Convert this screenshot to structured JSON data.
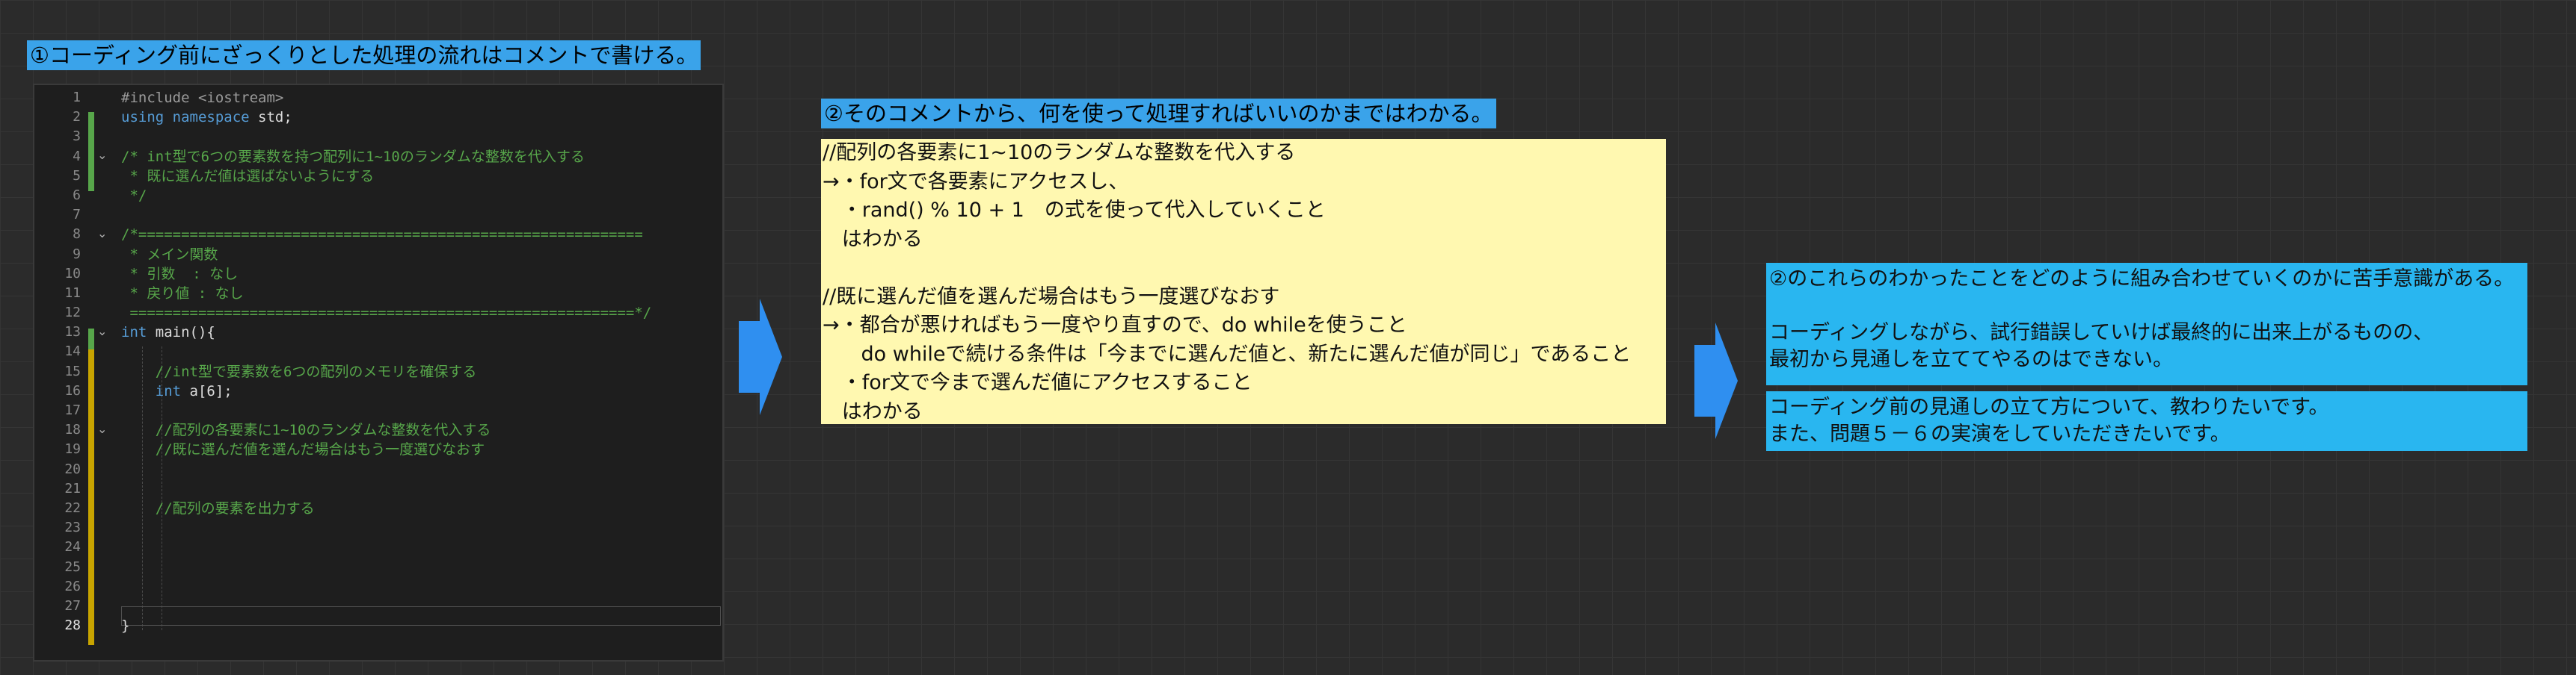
{
  "colors": {
    "canvas_bg": "#2b2b2b",
    "label_bg": "#3aa3ea",
    "note_bg": "#fff8b0",
    "box_bg": "#29b6f0",
    "arrow": "#2f8ff0",
    "editor_bg": "#1e1e1e"
  },
  "label1": "①コーディング前にざっくりとした処理の流れはコメントで書ける。",
  "label2": "②そのコメントから、何を使って処理すればいいのかまではわかる。",
  "editor": {
    "line_numbers": [
      "1",
      "2",
      "3",
      "4",
      "5",
      "6",
      "7",
      "8",
      "9",
      "10",
      "11",
      "12",
      "13",
      "14",
      "15",
      "16",
      "17",
      "18",
      "19",
      "20",
      "21",
      "22",
      "23",
      "24",
      "25",
      "26",
      "27",
      "28"
    ],
    "line1": "#include <iostream>",
    "line2_kw": "using namespace",
    "line2_tx": " std;",
    "line4": "/* int型で6つの要素数を持つ配列に1~10のランダムな整数を代入する",
    "line5": " * 既に選んだ値は選ばないようにする",
    "line6": " */",
    "line8": "/*===========================================================",
    "line9": " * メイン関数",
    "line10": " * 引数  : なし",
    "line11": " * 戻り値 : なし",
    "line12": " ===========================================================*/",
    "line13_kw": "int",
    "line13_tx": " main(){",
    "line15": "    //int型で要素数を6つの配列のメモリを確保する",
    "line16_kw": "    int",
    "line16_tx": " a[6];",
    "line18": "    //配列の各要素に1~10のランダムな整数を代入する",
    "line19": "    //既に選んだ値を選んだ場合はもう一度選びなおす",
    "line22": "    //配列の要素を出力する",
    "line28": "}"
  },
  "note": {
    "lines": [
      "//配列の各要素に1~10のランダムな整数を代入する",
      "→・for文で各要素にアクセスし、",
      "   ・rand() % 10 + 1　の式を使って代入していくこと",
      "   はわかる",
      "",
      "//既に選んだ値を選んだ場合はもう一度選びなおす",
      "→・都合が悪ければもう一度やり直すので、do whileを使うこと",
      "      do whileで続ける条件は「今までに選んだ値と、新たに選んだ値が同じ」であること",
      "   ・for文で今まで選んだ値にアクセスすること",
      "   はわかる"
    ]
  },
  "box1": {
    "lines": [
      "②のこれらのわかったことをどのように組み合わせていくのかに苦手意識がある。",
      "",
      "コーディングしながら、試行錯誤していけば最終的に出来上がるものの、",
      "最初から見通しを立ててやるのはできない。"
    ]
  },
  "box2": {
    "lines": [
      "コーディング前の見通しの立て方について、教わりたいです。",
      "また、問題５－６の実演をしていただきたいです。"
    ]
  }
}
